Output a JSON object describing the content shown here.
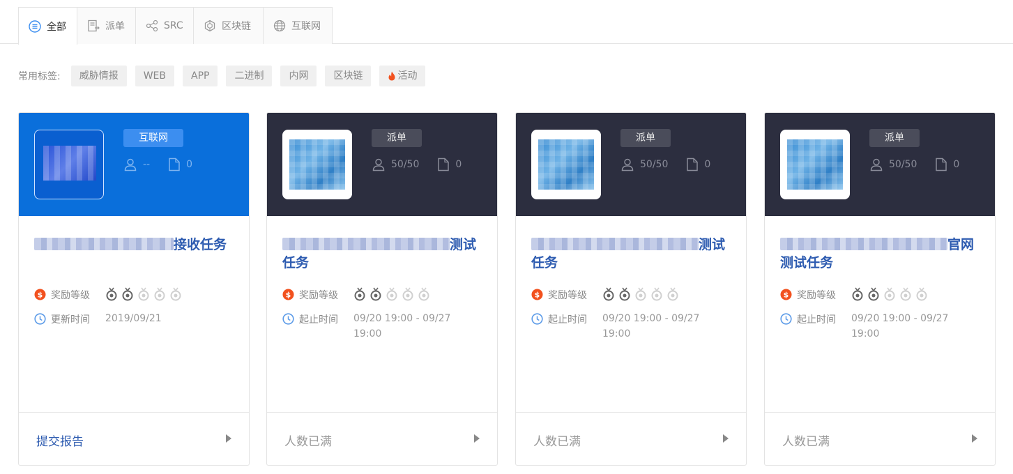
{
  "tabs": [
    {
      "label": "全部",
      "icon": "list-circle-icon",
      "active": true
    },
    {
      "label": "派单",
      "icon": "document-arrow-icon",
      "active": false
    },
    {
      "label": "SRC",
      "icon": "share-nodes-icon",
      "active": false
    },
    {
      "label": "区块链",
      "icon": "blockchain-cube-icon",
      "active": false
    },
    {
      "label": "互联网",
      "icon": "globe-icon",
      "active": false
    }
  ],
  "tags": {
    "label": "常用标签:",
    "items": [
      "威胁情报",
      "WEB",
      "APP",
      "二进制",
      "内网",
      "区块链",
      "活动"
    ]
  },
  "colors": {
    "accent": "#0a6fdb",
    "dark_header": "#2c2e3f",
    "title_blue": "#2d5bb0",
    "reward_red": "#f2511e",
    "clock_blue": "#5a9ae8"
  },
  "cards": [
    {
      "badge": "互联网",
      "participants": "--",
      "reports": "0",
      "title_suffix": "接收任务",
      "reward_label": "奖励等级",
      "reward_level": 2,
      "reward_max": 5,
      "time_label": "更新时间",
      "time_value": "2019/09/21",
      "footer": "提交报告",
      "footer_active": true
    },
    {
      "badge": "派单",
      "participants": "50/50",
      "reports": "0",
      "title_suffix": "测试",
      "title_line2": "任务",
      "reward_label": "奖励等级",
      "reward_level": 2,
      "reward_max": 5,
      "time_label": "起止时间",
      "time_value": "09/20 19:00 - 09/27 19:00",
      "footer": "人数已满",
      "footer_active": false
    },
    {
      "badge": "派单",
      "participants": "50/50",
      "reports": "0",
      "title_suffix": "测试",
      "title_line2": "任务",
      "reward_label": "奖励等级",
      "reward_level": 2,
      "reward_max": 5,
      "time_label": "起止时间",
      "time_value": "09/20 19:00 - 09/27 19:00",
      "footer": "人数已满",
      "footer_active": false
    },
    {
      "badge": "派单",
      "participants": "50/50",
      "reports": "0",
      "title_suffix": "官网",
      "title_line2": "测试任务",
      "reward_label": "奖励等级",
      "reward_level": 2,
      "reward_max": 5,
      "time_label": "起止时间",
      "time_value": "09/20 19:00 - 09/27 19:00",
      "footer": "人数已满",
      "footer_active": false
    }
  ]
}
